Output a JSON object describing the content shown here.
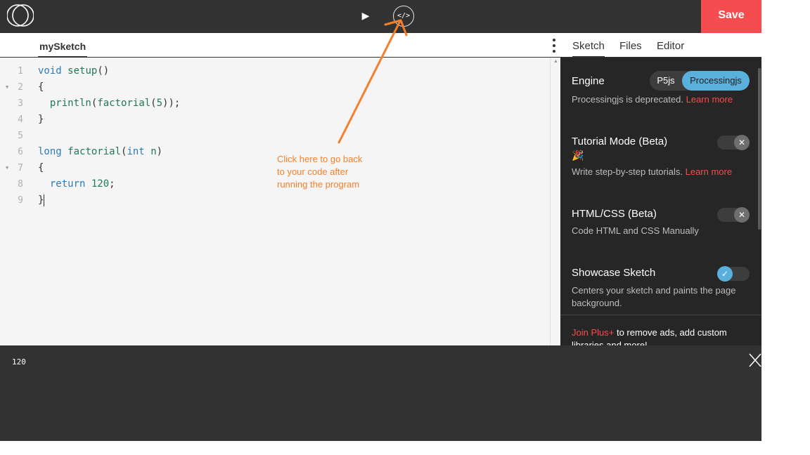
{
  "topbar": {
    "logo_icon": "openprocessing-logo-icon",
    "play_icon": "play-icon",
    "play_glyph": "▶",
    "code_icon": "code-icon",
    "code_glyph": "</>",
    "save_label": "Save",
    "save_color": "#f54c4f"
  },
  "editor": {
    "file_tab": "mySketch",
    "lines": [
      {
        "n": "1",
        "text": "void setup()"
      },
      {
        "n": "2",
        "text": "{"
      },
      {
        "n": "3",
        "text": "  println(factorial(5));"
      },
      {
        "n": "4",
        "text": "}"
      },
      {
        "n": "5",
        "text": ""
      },
      {
        "n": "6",
        "text": "long factorial(int n)"
      },
      {
        "n": "7",
        "text": "{"
      },
      {
        "n": "8",
        "text": "  return 120;"
      },
      {
        "n": "9",
        "text": "}"
      }
    ]
  },
  "annotation": {
    "text_1": "Click here to go back",
    "text_2": "to your code after",
    "text_3": "running the program",
    "color": "#f37f2d"
  },
  "panel": {
    "tabs": [
      "Sketch",
      "Files",
      "Editor"
    ],
    "engine": {
      "title": "Engine",
      "options": [
        "P5js",
        "Processingjs"
      ],
      "selected": "Processingjs",
      "desc": "Processingjs is deprecated.",
      "link": "Learn more"
    },
    "tutorial": {
      "title": "Tutorial Mode (Beta)",
      "desc": "Write step-by-step tutorials.",
      "link": "Learn more",
      "emoji": "🎉"
    },
    "htmlcss": {
      "title": "HTML/CSS (Beta)",
      "desc": "Code HTML and CSS Manually"
    },
    "showcase": {
      "title": "Showcase Sketch",
      "desc": "Centers your sketch and paints the page background."
    },
    "plus": {
      "link": "Join Plus+",
      "text": " to remove ads, add custom libraries and more!"
    }
  },
  "console": {
    "output": "120"
  }
}
